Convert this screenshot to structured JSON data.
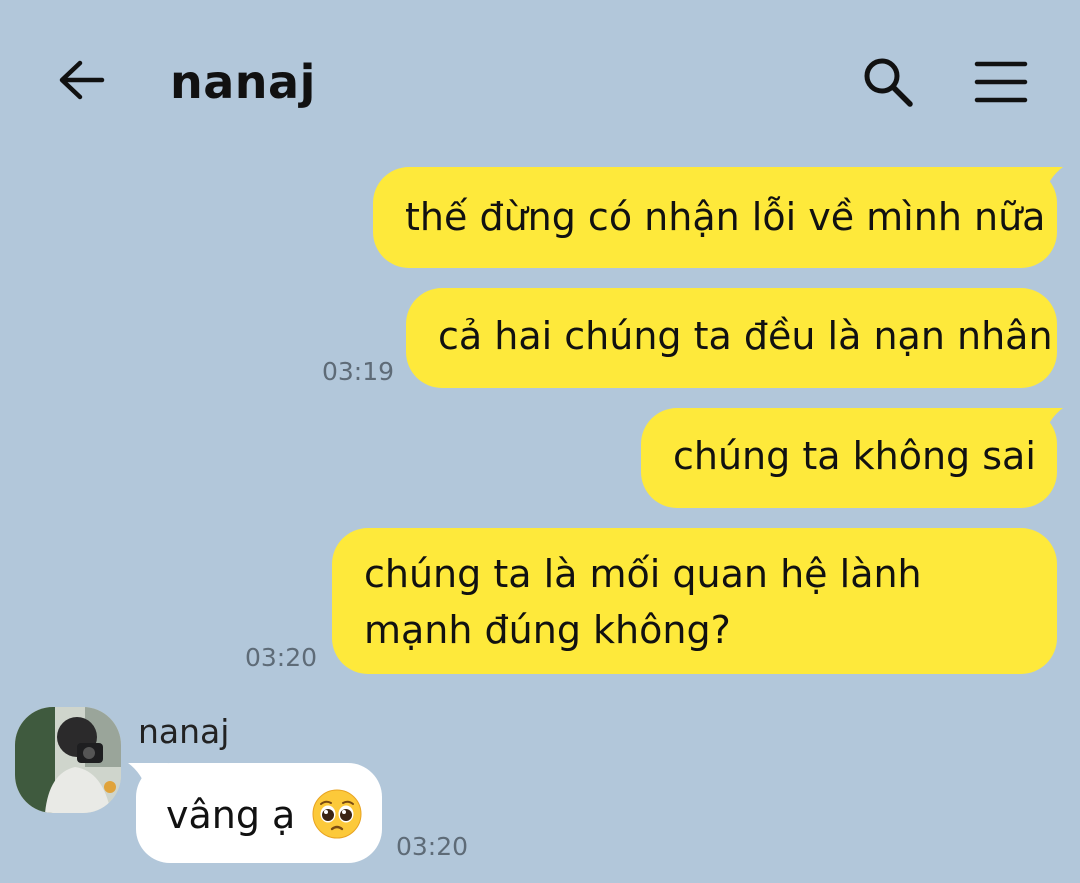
{
  "header": {
    "title": "nanaj"
  },
  "messages": {
    "sent": [
      {
        "text": "thế đừng có nhận lỗi về mình nữa"
      },
      {
        "text": "cả hai chúng ta đều là nạn nhân",
        "time": "03:19"
      },
      {
        "text": "chúng ta không sai"
      },
      {
        "text": "chúng ta là mối quan hệ lành mạnh đúng không?",
        "time": "03:20"
      }
    ],
    "received": [
      {
        "sender": "nanaj",
        "text": "vâng ạ",
        "emoji": "pleading-face-icon",
        "time": "03:20"
      }
    ]
  },
  "colors": {
    "background": "#b2c7da",
    "sent_bubble": "#fee93b",
    "received_bubble": "#ffffff",
    "timestamp": "#5e6b77"
  }
}
